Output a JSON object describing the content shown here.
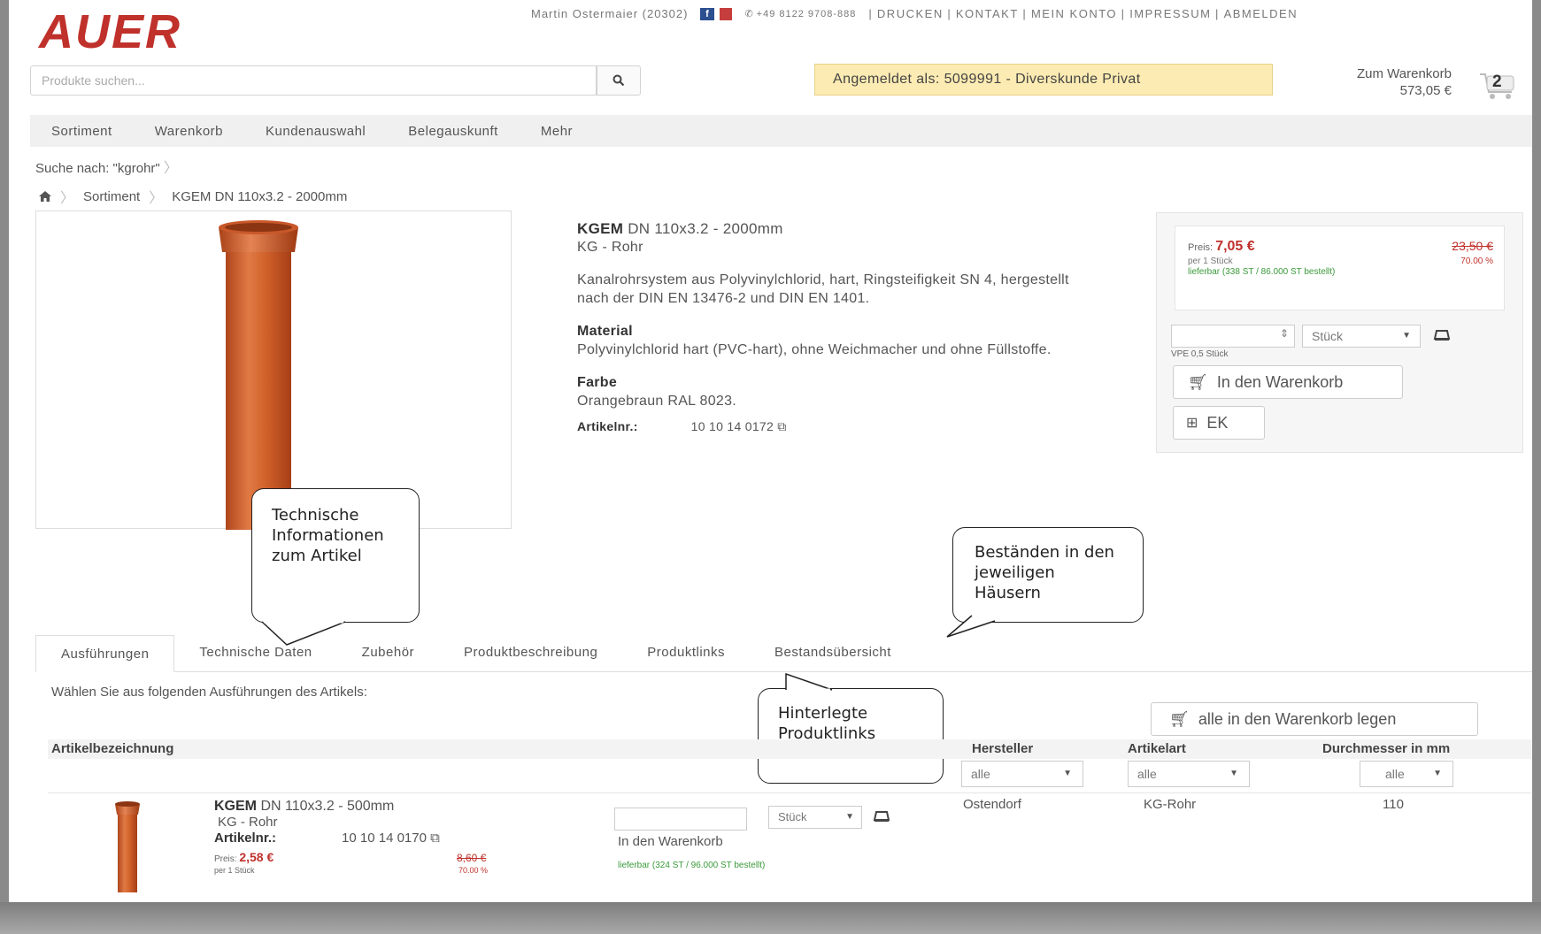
{
  "header": {
    "logo_text": "AUER",
    "user": "Martin Ostermaier (20302)",
    "phone": "+49 8122 9708-888",
    "links": [
      "DRUCKEN",
      "KONTAKT",
      "MEIN KONTO",
      "IMPRESSUM",
      "ABMELDEN"
    ],
    "search_placeholder": "Produkte suchen...",
    "logged_in": "Angemeldet als: 5099991 - Diverskunde Privat",
    "cart_label": "Zum Warenkorb",
    "cart_total": "573,05 €",
    "cart_count": "2"
  },
  "nav": [
    "Sortiment",
    "Warenkorb",
    "Kundenauswahl",
    "Belegauskunft",
    "Mehr"
  ],
  "breadcrumb": {
    "search": "Suche nach: \"kgrohr\"",
    "level1": "Sortiment",
    "current": "KGEM DN 110x3.2 - 2000mm"
  },
  "product": {
    "name_bold": "KGEM",
    "name_rest": "DN 110x3.2 - 2000mm",
    "subtitle": "KG - Rohr",
    "description": "Kanalrohrsystem aus Polyvinylchlorid, hart, Ringsteifigkeit SN 4, hergestellt nach der DIN EN 13476-2 und DIN EN 1401.",
    "material_label": "Material",
    "material_text": "Polyvinylchlorid hart (PVC-hart), ohne Weichmacher und ohne Füllstoffe.",
    "color_label": "Farbe",
    "color_text": "Orangebraun RAL 8023.",
    "artnr_label": "Artikelnr.:",
    "artnr": "10 10 14 0172"
  },
  "price_panel": {
    "price_label": "Preis:",
    "price": "7,05 €",
    "old_price": "23,50 €",
    "per": "per 1 Stück",
    "discount": "70.00 %",
    "availability": "lieferbar (338 ST / 86.000 ST bestellt)",
    "unit": "Stück",
    "vpe": "VPE 0,5 Stück",
    "add_to_cart": "In den Warenkorb",
    "ek": "EK"
  },
  "callouts": {
    "technical": "Technische Informationen zum Artikel",
    "stock": "Beständen in den jeweiligen Häusern",
    "links": "Hinterlegte Produktlinks"
  },
  "tabs": [
    "Ausführungen",
    "Technische Daten",
    "Zubehör",
    "Produktbeschreibung",
    "Produktlinks",
    "Bestandsübersicht"
  ],
  "variants": {
    "intro": "Wählen Sie aus folgenden Ausführungen des Artikels:",
    "add_all": "alle in den Warenkorb legen",
    "columns": {
      "name": "Artikelbezeichnung",
      "manufacturer": "Hersteller",
      "type": "Artikelart",
      "diameter": "Durchmesser in mm"
    },
    "filter_all": "alle",
    "row": {
      "name_bold": "KGEM",
      "name_rest": "DN 110x3.2 - 500mm",
      "subtitle": "KG - Rohr",
      "artnr_label": "Artikelnr.:",
      "artnr": "10 10 14 0170",
      "price_label": "Preis:",
      "price": "2,58 €",
      "per": "per 1 Stück",
      "old_price": "8,60 €",
      "discount": "70.00 %",
      "unit": "Stück",
      "add_to_cart": "In den Warenkorb",
      "availability": "lieferbar (324 ST / 96.000 ST bestellt)",
      "manufacturer": "Ostendorf",
      "type": "KG-Rohr",
      "diameter": "110"
    }
  },
  "colors": {
    "brand_red": "#c0312b",
    "pipe_orange": "#d2622b",
    "login_bg": "#fcebb2",
    "price_red": "#c0312b",
    "availability_green": "#3a9a3a"
  }
}
